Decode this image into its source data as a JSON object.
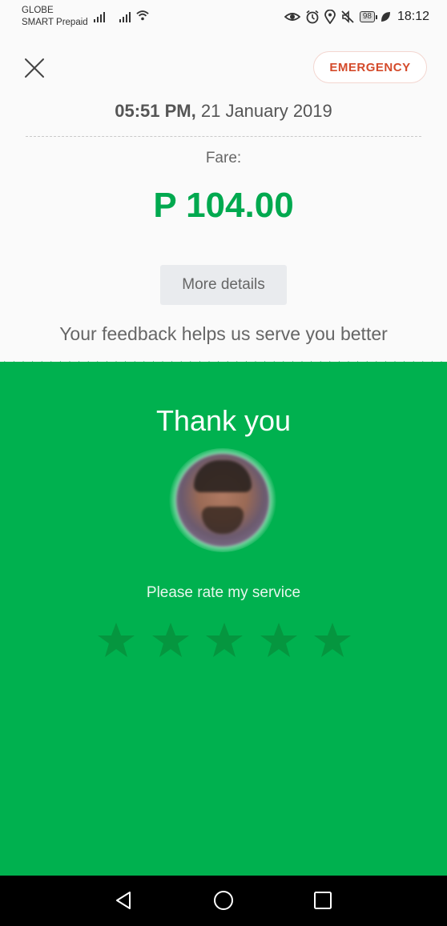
{
  "status_bar": {
    "carrier_1": "GLOBE",
    "carrier_2": "SMART Prepaid",
    "battery_level": "98",
    "time": "18:12",
    "icons": [
      "eye-icon",
      "alarm-icon",
      "location-icon",
      "mute-icon",
      "battery-icon",
      "leaf-icon"
    ]
  },
  "header": {
    "emergency_label": "EMERGENCY"
  },
  "trip": {
    "time": "05:51 PM,",
    "date": "21 January 2019",
    "fare_label": "Fare:",
    "fare_amount": "P 104.00",
    "more_details_label": "More details",
    "feedback_text": "Your feedback helps us serve you better"
  },
  "rating": {
    "thank_you": "Thank you",
    "prompt": "Please rate my service",
    "max_stars": 5,
    "selected_stars": 0
  },
  "colors": {
    "brand_green": "#00b14f",
    "emergency_red": "#d44a2a",
    "star_unselected": "#05963f"
  }
}
